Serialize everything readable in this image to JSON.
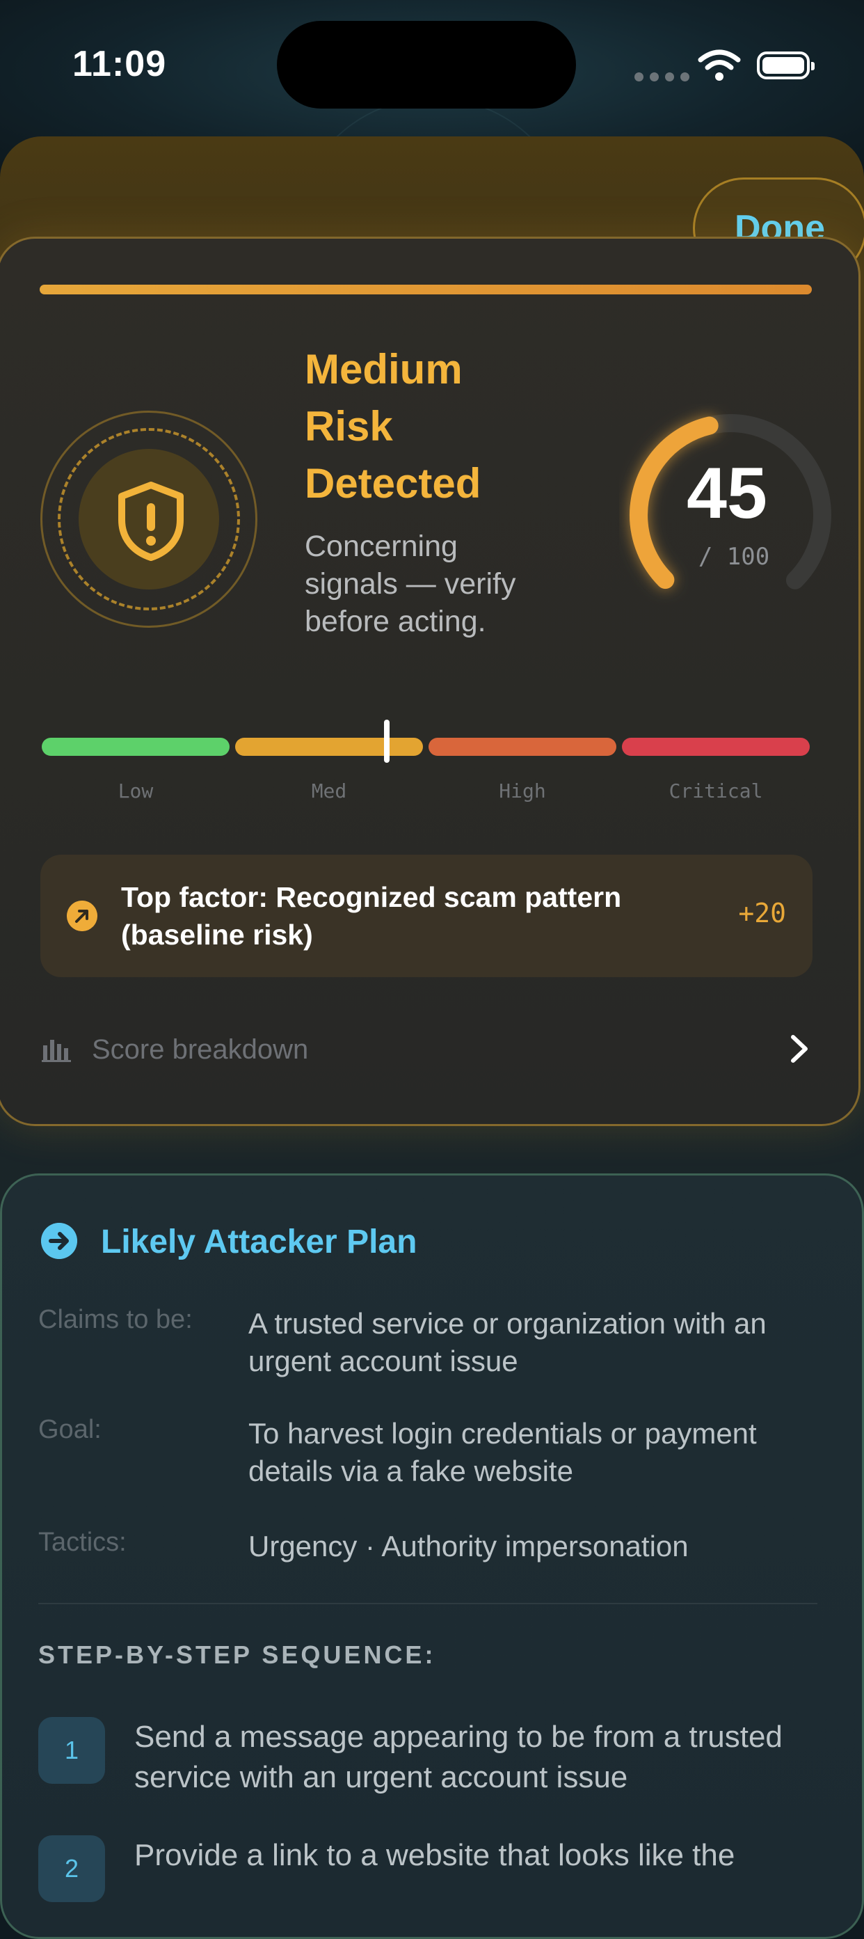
{
  "status_bar": {
    "time": "11:09"
  },
  "header": {
    "done_label": "Done"
  },
  "risk": {
    "title": "Medium Risk Detected",
    "description": "Concerning signals — verify before acting.",
    "score": "45",
    "score_max": "/ 100",
    "score_fraction": 0.45,
    "scale_labels": [
      "Low",
      "Med",
      "High",
      "Critical"
    ],
    "top_factor": "Top factor: Recognized scam pattern (baseline risk)",
    "top_factor_value": "+20",
    "breakdown_label": "Score breakdown",
    "colors": {
      "accent": "#f4b53c",
      "low": "#5dd16a",
      "med": "#e3a431",
      "high": "#d9663b",
      "critical": "#d9404c"
    }
  },
  "attacker_plan": {
    "title": "Likely Attacker Plan",
    "rows": [
      {
        "key": "Claims to be:",
        "value": "A trusted service or organization with an urgent account issue"
      },
      {
        "key": "Goal:",
        "value": "To harvest login credentials or payment details via a fake website"
      },
      {
        "key": "Tactics:",
        "value": "Urgency · Authority impersonation"
      }
    ],
    "sequence_heading": "STEP-BY-STEP SEQUENCE:",
    "steps": [
      {
        "num": "1",
        "text": "Send a message appearing to be from a trusted service with an urgent account issue"
      },
      {
        "num": "2",
        "text": "Provide a link to a website that looks like the"
      }
    ]
  }
}
